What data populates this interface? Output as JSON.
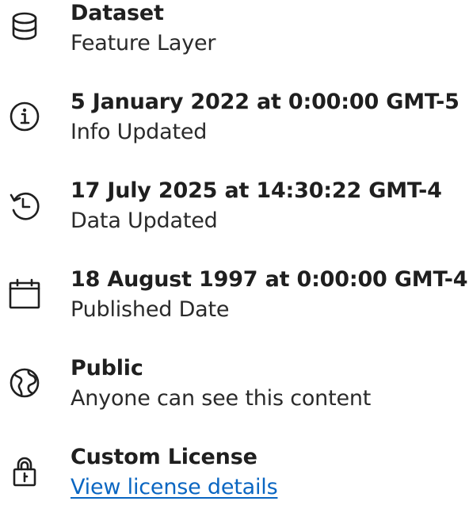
{
  "items": [
    {
      "icon": "database-icon",
      "title": "Dataset",
      "subtitle": "Feature Layer"
    },
    {
      "icon": "info-icon",
      "title": "5 January 2022 at 0:00:00 GMT-5",
      "subtitle": "Info Updated"
    },
    {
      "icon": "history-icon",
      "title": "17 July 2025 at 14:30:22 GMT-4",
      "subtitle": "Data Updated"
    },
    {
      "icon": "calendar-icon",
      "title": "18 August 1997 at 0:00:00 GMT-4",
      "subtitle": "Published Date"
    },
    {
      "icon": "globe-icon",
      "title": "Public",
      "subtitle": "Anyone can see this content"
    },
    {
      "icon": "lock-icon",
      "title": "Custom License",
      "subtitle": "View license details"
    }
  ],
  "colors": {
    "text": "#1f1f1f",
    "link": "#0a66c2"
  }
}
